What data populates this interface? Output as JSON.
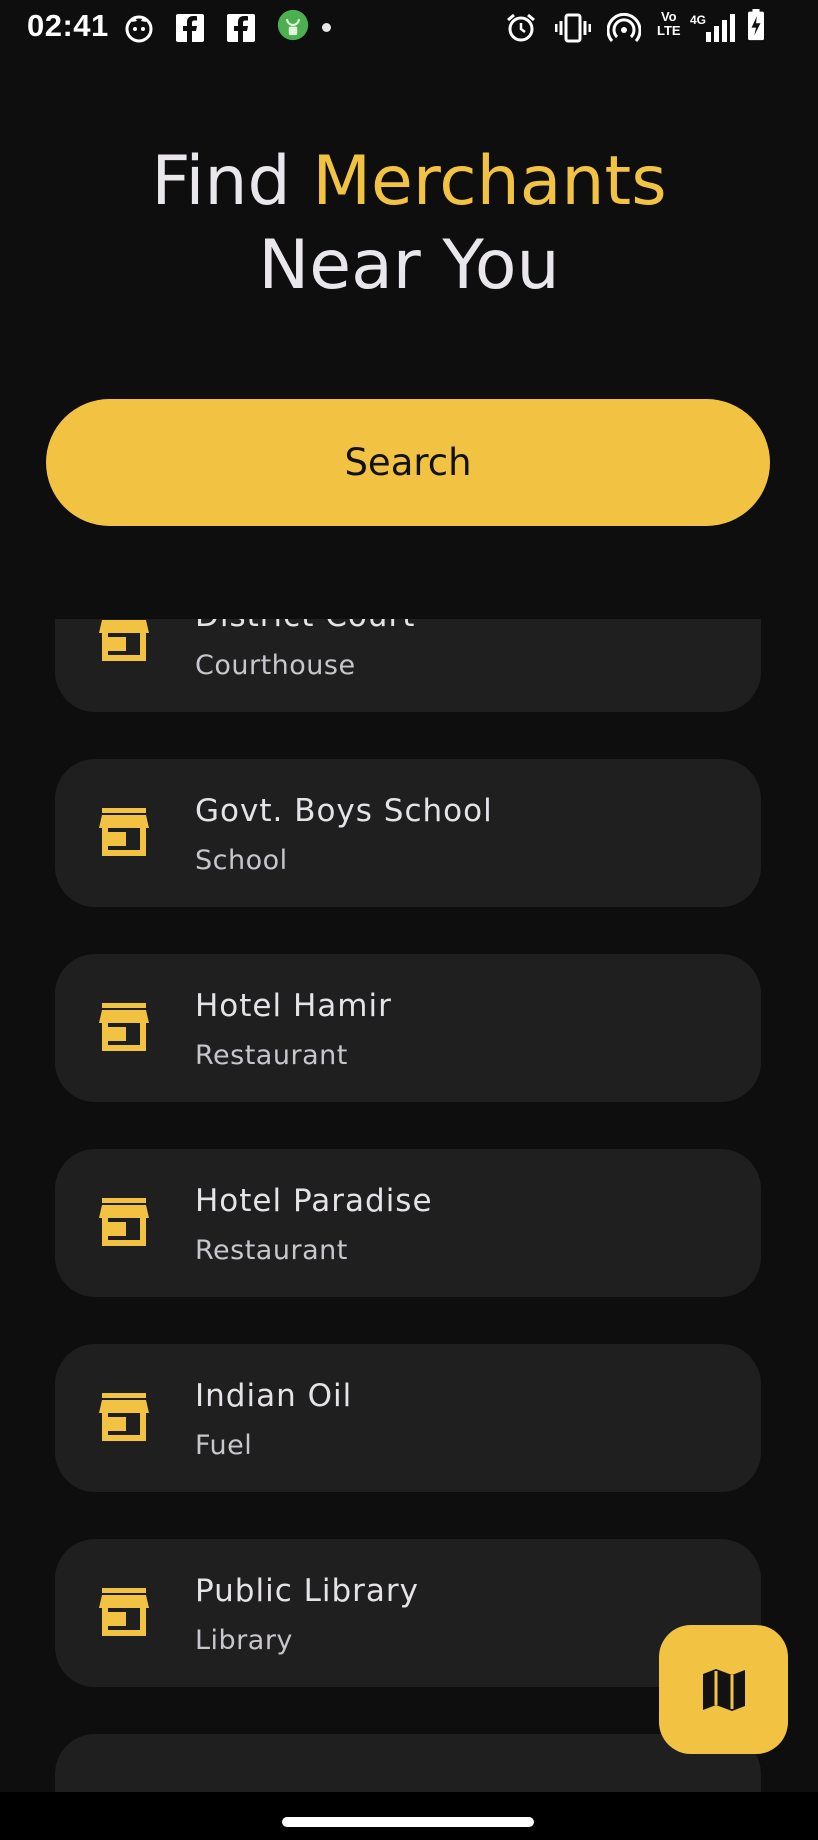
{
  "status_bar": {
    "time": "02:41",
    "network_label_top": "Vo",
    "network_label_bottom": "LTE",
    "network_type": "4G",
    "icons": [
      "cat-icon",
      "facebook-icon",
      "facebook-icon",
      "android-icon",
      "alarm-icon",
      "vibrate-icon",
      "hotspot-icon",
      "signal-icon",
      "battery-charging-icon"
    ]
  },
  "header": {
    "title_part1": "Find ",
    "title_accent": "Merchants",
    "title_line2": "Near You"
  },
  "search": {
    "label": "Search"
  },
  "merchants": [
    {
      "name": "District Court",
      "category": "Courthouse",
      "icon": "store-icon"
    },
    {
      "name": "Govt. Boys School",
      "category": "School",
      "icon": "store-icon"
    },
    {
      "name": "Hotel Hamir",
      "category": "Restaurant",
      "icon": "store-icon"
    },
    {
      "name": "Hotel Paradise",
      "category": "Restaurant",
      "icon": "store-icon"
    },
    {
      "name": "Indian Oil",
      "category": "Fuel",
      "icon": "store-icon"
    },
    {
      "name": "Public Library",
      "category": "Library",
      "icon": "store-icon"
    }
  ],
  "fab": {
    "icon": "map-icon"
  },
  "colors": {
    "background": "#0e0e0e",
    "card": "#1f1f1f",
    "accent": "#f2c242",
    "text": "#e9e6ec"
  }
}
